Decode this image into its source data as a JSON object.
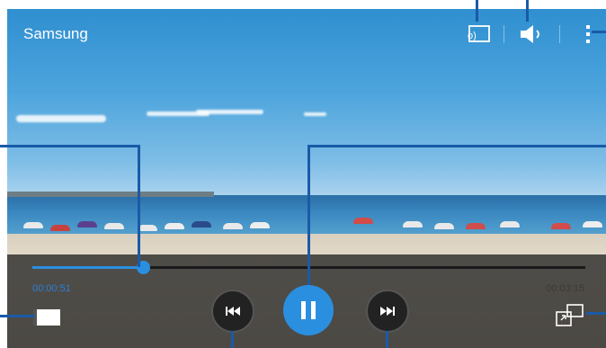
{
  "video": {
    "title": "Samsung"
  },
  "progress": {
    "position_fraction": 0.2,
    "elapsed_time": "00:00:51",
    "total_time": "00:03:15"
  },
  "icons": {
    "screen_mirroring": "screen-mirroring-icon",
    "volume": "volume-icon",
    "more_options": "more-options-icon",
    "screen_ratio": "screen-ratio-icon",
    "previous": "previous-icon",
    "pause": "pause-icon",
    "next": "next-icon",
    "popup_player": "popup-player-icon"
  },
  "colors": {
    "accent": "#2b8fe0",
    "callout": "#1a5aa8"
  }
}
